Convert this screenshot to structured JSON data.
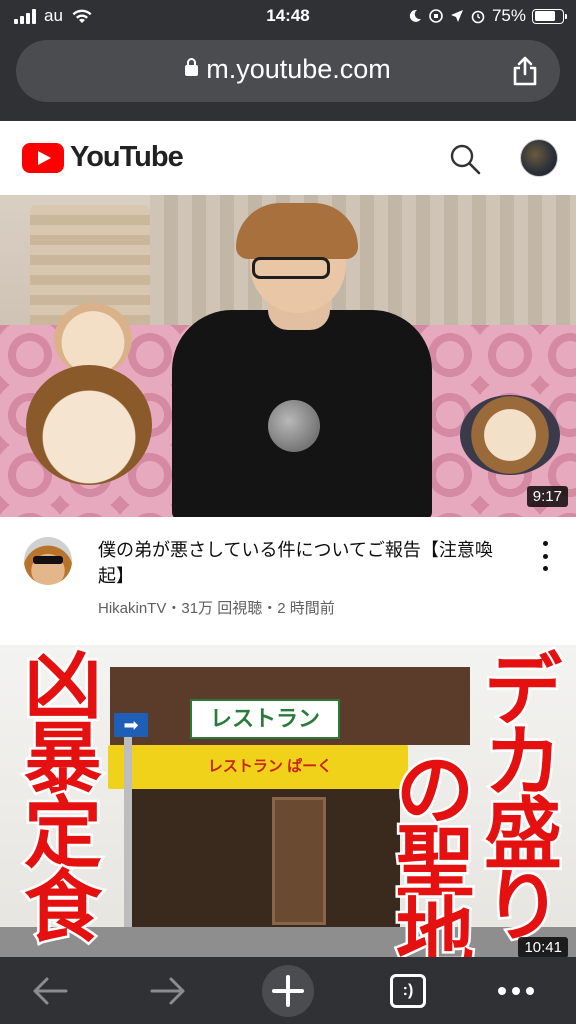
{
  "status_bar": {
    "carrier": "au",
    "time": "14:48",
    "battery_percent": "75%",
    "battery_level": 0.75
  },
  "browser": {
    "url": "m.youtube.com"
  },
  "youtube": {
    "logo_text": "YouTube"
  },
  "videos": [
    {
      "title": "僕の弟が悪さしている件についてご報告【注意喚起】",
      "channel": "HikakinTV",
      "meta": "HikakinTV・31万 回視聴・2 時間前",
      "duration": "9:17"
    },
    {
      "duration": "10:41",
      "overlay_left": [
        "凶",
        "暴",
        "定",
        "食"
      ],
      "overlay_right_a": [
        "デ",
        "カ",
        "盛",
        "り"
      ],
      "overlay_right_b": [
        "の",
        "聖",
        "地"
      ],
      "shop_sign": "レストラン",
      "awning_text": "レストラン ぱーく"
    }
  ],
  "toolbar": {
    "tabs_label": ":)"
  },
  "colors": {
    "chrome": "#2f3134",
    "youtube_red": "#ff0000",
    "overlay_red": "#e51111"
  }
}
